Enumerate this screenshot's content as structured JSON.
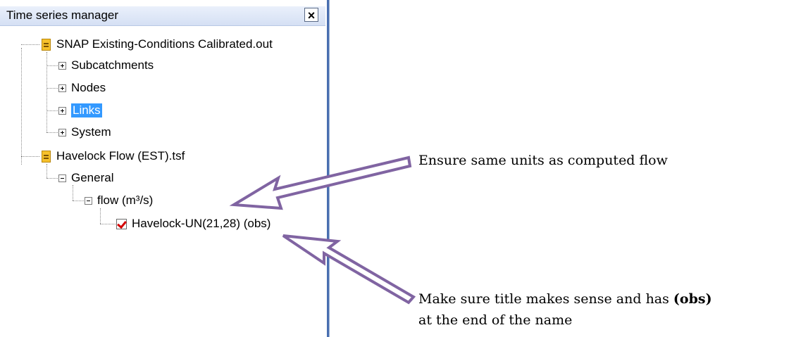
{
  "panel": {
    "title": "Time series manager",
    "close_glyph": "×"
  },
  "tree": {
    "file1": {
      "label": "SNAP Existing-Conditions Calibrated.out",
      "children": [
        "Subcatchments",
        "Nodes",
        "Links",
        "System"
      ],
      "selected": "Links"
    },
    "file2": {
      "label": "Havelock Flow (EST).tsf",
      "group": "General",
      "subgroup": "flow (m³/s)",
      "series": "Havelock-UN(21,28) (obs)",
      "series_checked": true
    }
  },
  "annotations": {
    "units_note": "Ensure same units as computed flow",
    "title_note_line1": "Make sure title makes sense and has ",
    "title_note_bold": "(obs)",
    "title_note_line2": "at the end of the name"
  },
  "colors": {
    "selection": "#3399ff",
    "arrow_fill": "#ffffff",
    "arrow_stroke": "#8064a2",
    "check": "#d40000",
    "panel_border": "#4a6fb0"
  }
}
